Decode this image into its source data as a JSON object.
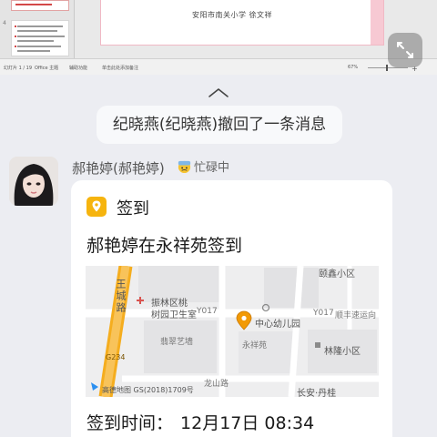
{
  "top_shot": {
    "slide_caption": "安阳市南关小学    徐文祥",
    "thumb_numbers": [
      "",
      "4"
    ],
    "statusbar": {
      "left_items": [
        "幻灯片 1 / 19",
        "Office 主题",
        "辅助功能"
      ],
      "mid_item": "单击此处添加备注",
      "zoom": "67%"
    }
  },
  "recall_notice": "纪晓燕(纪晓燕)撤回了一条消息",
  "message": {
    "sender": "郝艳婷(郝艳婷)",
    "status": "忙碌中",
    "card": {
      "title": "签到",
      "text": "郝艳婷在永祥苑签到",
      "time_label": "签到时间：",
      "time_value": "12月17日 08:34",
      "map": {
        "labels": {
          "road_wangcheng": "王城路",
          "clinic_line1": "振林区桃",
          "clinic_line2": "树园卫生室",
          "y017_left": "Y017",
          "kindergarten": "中心幼儿园",
          "y017_right": "Y017",
          "express": "顺丰速运向",
          "yijingxiaoqu": "颐鑫小区",
          "cuifengyi": "翡翠艺墙",
          "yongxiangyuan": "永祥苑",
          "linlong": "林隆小区",
          "longshan": "龙山路",
          "g234": "G234",
          "amap_copyright": "高德地图  GS(2018)1709号",
          "changan": "长安·丹桂"
        }
      }
    }
  },
  "colors": {
    "background": "#ecedf2",
    "card": "#ffffff",
    "accent_yellow": "#f6b40e",
    "map_road": "#f2a91f",
    "map_bg": "#eeeeef"
  }
}
